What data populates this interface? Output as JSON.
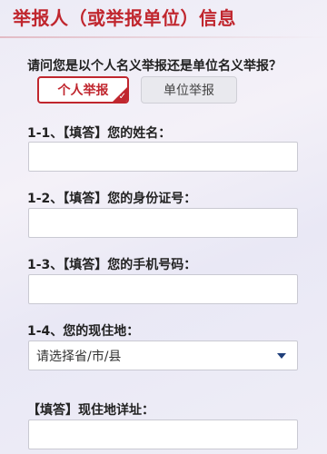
{
  "header": {
    "title": "举报人（或举报单位）信息"
  },
  "reporter_type": {
    "question": "请问您是以个人名义举报还是单位名义举报？",
    "options": [
      {
        "label": "个人举报",
        "selected": true
      },
      {
        "label": "单位举报",
        "selected": false
      }
    ],
    "check_icon": "✓"
  },
  "fields": [
    {
      "label": "1-1、【填答】您的姓名：",
      "value": ""
    },
    {
      "label": "1-2、【填答】您的身份证号：",
      "value": ""
    },
    {
      "label": "1-3、【填答】您的手机号码：",
      "value": ""
    },
    {
      "label": "1-4、您的现住地：",
      "select_value": "请选择省/市/县"
    },
    {
      "label": "【填答】现住地详址：",
      "value": ""
    }
  ],
  "colors": {
    "accent": "#c0262e",
    "caret": "#1f3f7a"
  }
}
